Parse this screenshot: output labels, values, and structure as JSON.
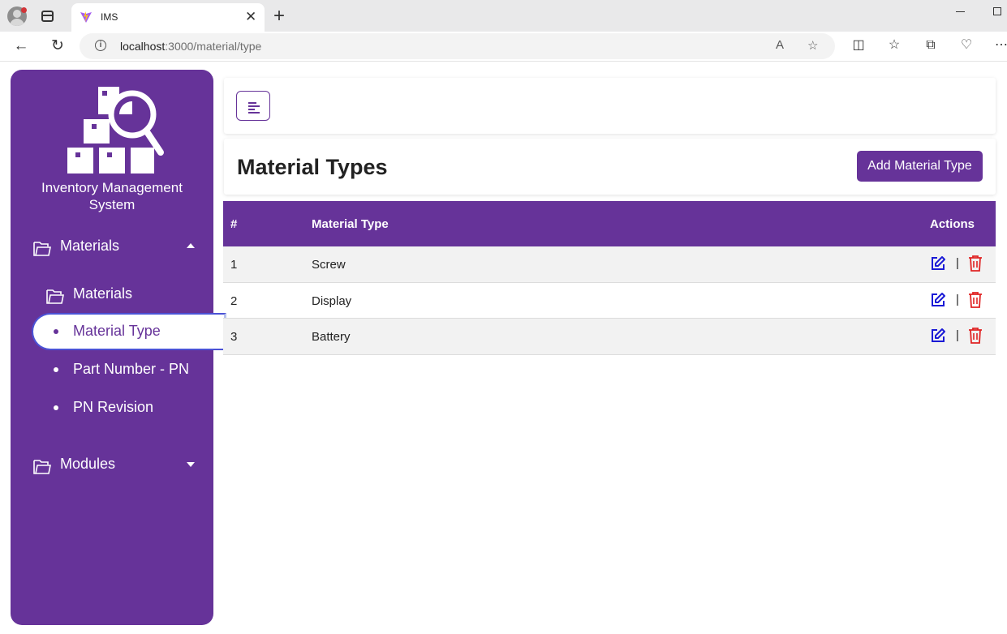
{
  "browser": {
    "tab_title": "IMS",
    "url_host": "localhost",
    "url_path": ":3000/material/type"
  },
  "sidebar": {
    "app_name_line1": "Inventory Management",
    "app_name_line2": "System",
    "sections": [
      {
        "label": "Materials",
        "expanded": true
      },
      {
        "label": "Modules",
        "expanded": false
      }
    ],
    "submenu_header": "Materials",
    "items": [
      {
        "label": "Material Type",
        "active": true
      },
      {
        "label": "Part Number - PN",
        "active": false
      },
      {
        "label": "PN Revision",
        "active": false
      }
    ]
  },
  "main": {
    "title": "Material Types",
    "add_button": "Add Material Type",
    "table": {
      "headers": {
        "num": "#",
        "name": "Material Type",
        "actions": "Actions"
      },
      "rows": [
        {
          "num": "1",
          "name": "Screw"
        },
        {
          "num": "2",
          "name": "Display"
        },
        {
          "num": "3",
          "name": "Battery"
        }
      ],
      "separator": "|"
    }
  },
  "colors": {
    "brand": "#663399",
    "edit": "#1a1ad6",
    "delete": "#e02424"
  }
}
